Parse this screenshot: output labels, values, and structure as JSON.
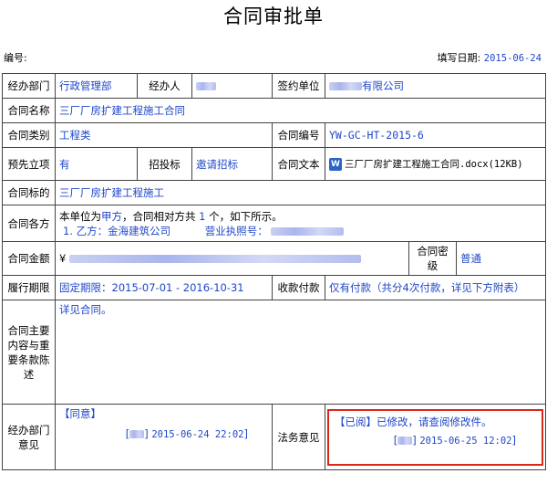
{
  "title": "合同审批单",
  "meta": {
    "serial_label": "编号:",
    "date_label": "填写日期:",
    "date_value": "2015-06-24"
  },
  "rows": {
    "dept_label": "经办部门",
    "dept_value": "行政管理部",
    "handler_label": "经办人",
    "sign_unit_label": "签约单位",
    "sign_unit_suffix": "有限公司",
    "name_label": "合同名称",
    "name_value": "三厂厂房扩建工程施工合同",
    "category_label": "合同类别",
    "category_value": "工程类",
    "number_label": "合同编号",
    "number_value": "YW-GC-HT-2015-6",
    "preset_label": "预先立项",
    "preset_value": "有",
    "bid_label": "招投标",
    "bid_value": "邀请招标",
    "text_label": "合同文本",
    "text_file": "三厂厂房扩建工程施工合同.docx(12KB)",
    "target_label": "合同标的",
    "target_value": "三厂厂房扩建工程施工",
    "parties_label": "合同各方",
    "parties_line_prefix": "本单位为",
    "parties_role": "甲方",
    "parties_line_mid": "，合同相对方共",
    "parties_count": "1",
    "parties_line_suffix": "个，如下所示。",
    "party_b": "1. 乙方：金海建筑公司",
    "license_label": "营业执照号：",
    "amount_label": "合同金额",
    "amount_currency": "¥",
    "secret_label": "合同密级",
    "secret_value": "普通",
    "period_label": "履行期限",
    "period_value": "固定期限：2015-07-01 - 2016-10-31",
    "payment_label": "收款付款",
    "payment_value": "仅有付款（共分4次付款，详见下方附表）",
    "content_label": "合同主要内容与重要条款陈述",
    "content_value": "详见合同。",
    "dept_opinion_label": "经办部门意见",
    "dept_opinion_value": "【同意】",
    "dept_opinion_time": "2015-06-24 22:02",
    "legal_label": "法务意见",
    "legal_value": "【已阅】已修改，请查阅修改件。",
    "legal_time": "2015-06-25 12:02"
  },
  "colors": {
    "text_value": "#1f47c8",
    "highlight_border": "#d9271e"
  }
}
